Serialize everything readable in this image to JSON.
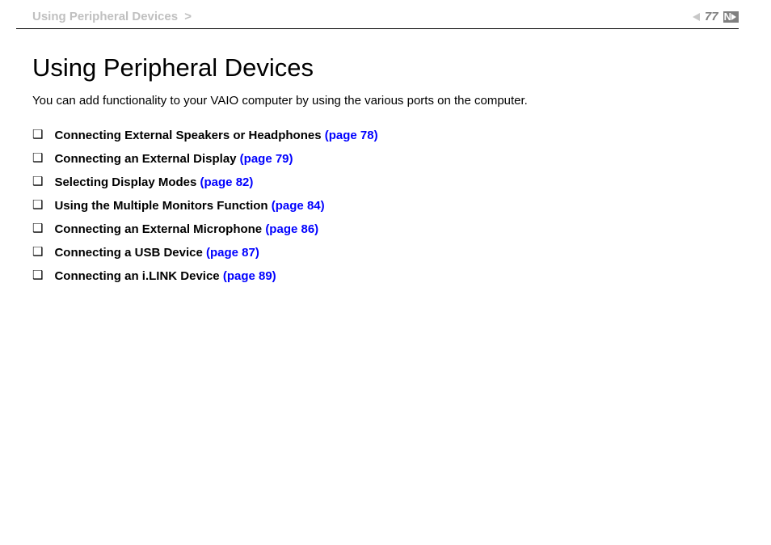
{
  "header": {
    "breadcrumb_text": "Using Peripheral Devices",
    "breadcrumb_sep": ">",
    "page_number": "77"
  },
  "content": {
    "title": "Using Peripheral Devices",
    "intro": "You can add functionality to your VAIO computer by using the various ports on the computer.",
    "items": [
      {
        "label": "Connecting External Speakers or Headphones ",
        "page": "(page 78)"
      },
      {
        "label": "Connecting an External Display ",
        "page": "(page 79)"
      },
      {
        "label": "Selecting Display Modes ",
        "page": "(page 82)"
      },
      {
        "label": "Using the Multiple Monitors Function ",
        "page": "(page 84)"
      },
      {
        "label": "Connecting an External Microphone ",
        "page": "(page 86)"
      },
      {
        "label": "Connecting a USB Device ",
        "page": "(page 87)"
      },
      {
        "label": "Connecting an i.LINK Device ",
        "page": "(page 89)"
      }
    ]
  }
}
